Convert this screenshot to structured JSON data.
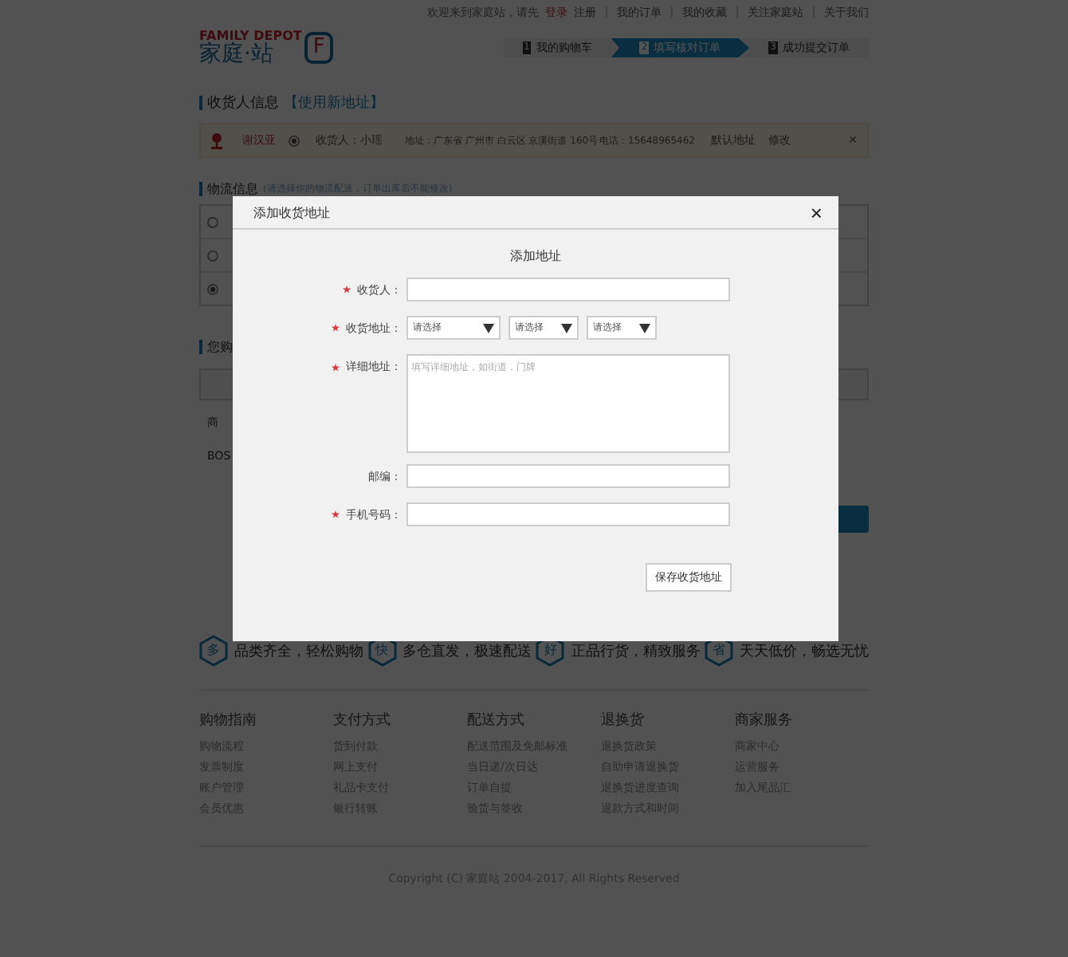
{
  "top_bar": {
    "greeting": "欢迎来到家庭站，请先",
    "login": "登录",
    "register": "注册",
    "links": [
      "我的订单",
      "我的收藏",
      "关注家庭站",
      "关于我们"
    ]
  },
  "logo": {
    "english": "FAMILY DEPOT",
    "chinese": "家庭·站",
    "mark": "F"
  },
  "steps": [
    {
      "number": "1",
      "label": "我的购物车",
      "selected": false
    },
    {
      "number": "2",
      "label": "填写核对订单",
      "selected": true
    },
    {
      "number": "3",
      "label": "成功提交订单",
      "selected": false
    }
  ],
  "receiver_section": {
    "title": "收货人信息",
    "link": "【使用新地址】"
  },
  "address_row": {
    "name": "谢汉亚",
    "selected": true,
    "receiver": "收货人：小瑶",
    "address": "地址：广东省 广州市 白云区 京溪街道 160号",
    "phone": "电话：15648965462",
    "default": "默认地址",
    "edit": "修改",
    "delete": "✕"
  },
  "logistics_section": {
    "title": "物流信息",
    "note": "(请选择你的物流配送，订单出库后不能修改)",
    "options": [
      {
        "selected": false
      },
      {
        "selected": false
      },
      {
        "selected": true
      }
    ]
  },
  "purchase_section": {
    "title": "您购",
    "rows": [
      "商",
      "BOS"
    ]
  },
  "modal": {
    "title": "添加收货地址",
    "close": "×",
    "heading": "添加地址",
    "fields": [
      {
        "kind": "text",
        "label": "收货人：",
        "required": true
      },
      {
        "kind": "selects",
        "label": "收货地址：",
        "required": true,
        "selects": [
          "请选择",
          "请选择",
          "请选择"
        ]
      },
      {
        "kind": "textarea",
        "label": "详细地址：",
        "required": true,
        "placeholder": "填写详细地址，如街道，门牌"
      },
      {
        "kind": "text",
        "label": "邮编：",
        "required": false
      },
      {
        "kind": "text",
        "label": "手机号码：",
        "required": true
      }
    ],
    "save_button": "保存收货地址"
  },
  "features": [
    {
      "icon": "多",
      "text": "品类齐全，轻松购物"
    },
    {
      "icon": "快",
      "text": "多仓直发，极速配送"
    },
    {
      "icon": "好",
      "text": "正品行货，精致服务"
    },
    {
      "icon": "省",
      "text": "天天低价，畅选无忧"
    }
  ],
  "footer_columns": [
    {
      "title": "购物指南",
      "links": [
        "购物流程",
        "发票制度",
        "账户管理",
        "会员优惠"
      ]
    },
    {
      "title": "支付方式",
      "links": [
        "货到付款",
        "网上支付",
        "礼品卡支付",
        "银行转账"
      ]
    },
    {
      "title": "配送方式",
      "links": [
        "配送范围及免邮标准",
        "当日递/次日达",
        "订单自提",
        "验货与签收"
      ]
    },
    {
      "title": "退换货",
      "links": [
        "退换货政策",
        "自助申请退换货",
        "退换货进度查询",
        "退款方式和时间"
      ]
    },
    {
      "title": "商家服务",
      "links": [
        "商家中心",
        "运营服务",
        "加入尾品汇"
      ]
    }
  ],
  "copyright": "Copyright (C) 家庭站 2004-2017, All Rights Reserved"
}
